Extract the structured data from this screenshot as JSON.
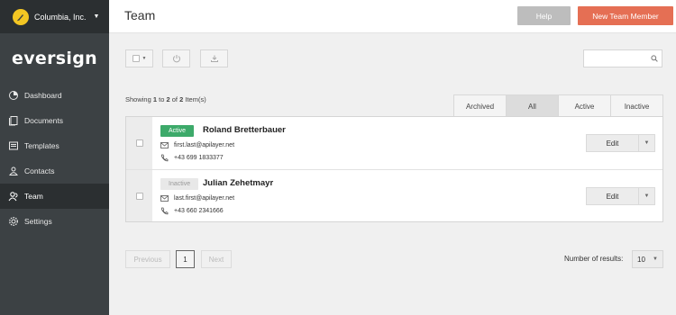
{
  "org": {
    "name": "Columbia, Inc.",
    "logo_icon": "feather-icon"
  },
  "brand": "eversign",
  "nav": [
    {
      "label": "Dashboard",
      "icon": "pie-chart-icon",
      "active": false
    },
    {
      "label": "Documents",
      "icon": "documents-icon",
      "active": false
    },
    {
      "label": "Templates",
      "icon": "templates-icon",
      "active": false
    },
    {
      "label": "Contacts",
      "icon": "contacts-icon",
      "active": false
    },
    {
      "label": "Team",
      "icon": "team-icon",
      "active": true
    },
    {
      "label": "Settings",
      "icon": "gear-icon",
      "active": false
    }
  ],
  "header": {
    "title": "Team",
    "help_label": "Help",
    "new_member_label": "New Team Member"
  },
  "toolbar": {
    "search_placeholder": ""
  },
  "listing": {
    "showing_prefix": "Showing",
    "from": "1",
    "to_word": "to",
    "to": "2",
    "of_word": "of",
    "total": "2",
    "suffix": "Item(s)"
  },
  "filters": [
    {
      "label": "Archived",
      "active": false
    },
    {
      "label": "All",
      "active": true
    },
    {
      "label": "Active",
      "active": false
    },
    {
      "label": "Inactive",
      "active": false
    }
  ],
  "members": [
    {
      "status": "Active",
      "name": "Roland Bretterbauer",
      "email": "first.last@apilayer.net",
      "phone": "+43 699 1833377",
      "edit_label": "Edit"
    },
    {
      "status": "Inactive",
      "name": "Julian Zehetmayr",
      "email": "last.first@apilayer.net",
      "phone": "+43 660 2341666",
      "edit_label": "Edit"
    }
  ],
  "pagination": {
    "previous": "Previous",
    "current": "1",
    "next": "Next",
    "results_label": "Number of results:",
    "results_value": "10"
  },
  "colors": {
    "sidebar": "#3c4144",
    "sidebar_dark": "#2b2f31",
    "accent": "#e56f54",
    "active_badge": "#3daa6a",
    "logo": "#f3c623"
  }
}
